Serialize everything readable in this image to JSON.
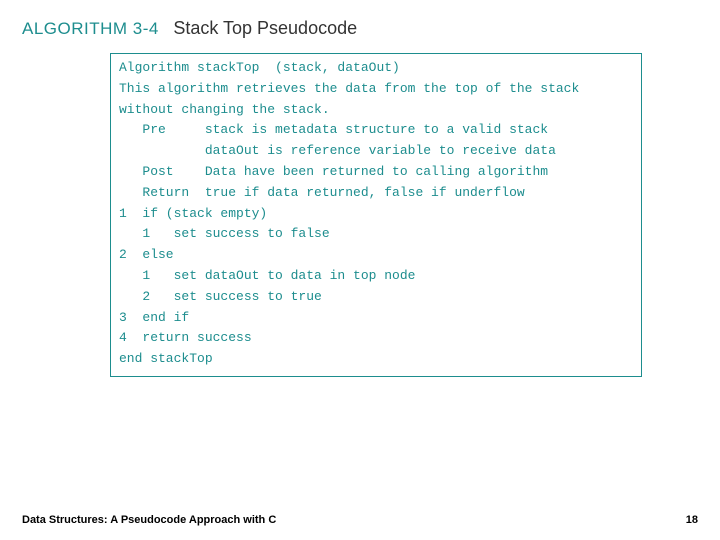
{
  "header": {
    "algo_number": "ALGORITHM 3-4",
    "algo_title": "Stack Top Pseudocode"
  },
  "code": {
    "lines": [
      "Algorithm stackTop  (stack, dataOut)",
      "This algorithm retrieves the data from the top of the stack",
      "without changing the stack.",
      "   Pre     stack is metadata structure to a valid stack",
      "           dataOut is reference variable to receive data",
      "   Post    Data have been returned to calling algorithm",
      "   Return  true if data returned, false if underflow",
      "1  if (stack empty)",
      "   1   set success to false",
      "2  else",
      "   1   set dataOut to data in top node",
      "   2   set success to true",
      "3  end if",
      "4  return success",
      "end stackTop"
    ]
  },
  "footer": {
    "text": "Data Structures: A Pseudocode Approach with C",
    "page": "18"
  }
}
